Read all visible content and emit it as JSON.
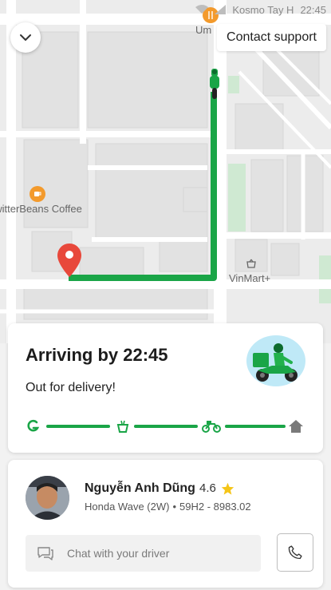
{
  "status_bar": {
    "carrier": "Kosmo Tay H",
    "time": "22:45"
  },
  "map": {
    "places": [
      {
        "name": "TwitterBeans Coffee",
        "icon": "coffee-icon"
      },
      {
        "name": "VinMart+",
        "icon": "basket-icon"
      },
      {
        "name": "Um",
        "icon": "restaurant-icon"
      }
    ]
  },
  "header": {
    "collapse_icon": "chevron-down-icon",
    "support_label": "Contact support"
  },
  "status": {
    "title": "Arriving by 22:45",
    "subtitle": "Out for delivery!",
    "progress_steps": [
      "grab-logo-icon",
      "food-bag-icon",
      "motorbike-icon",
      "home-icon"
    ]
  },
  "driver": {
    "name": "Nguyễn Anh Dũng",
    "rating": "4.6",
    "vehicle": "Honda Wave (2W)",
    "plate": "59H2 - 8983.02",
    "chat_placeholder": "Chat with your driver",
    "call_icon": "phone-icon"
  },
  "colors": {
    "route": "#1aa547",
    "pin": "#e8483b",
    "accent": "#00b14f",
    "star": "#f5c518"
  }
}
